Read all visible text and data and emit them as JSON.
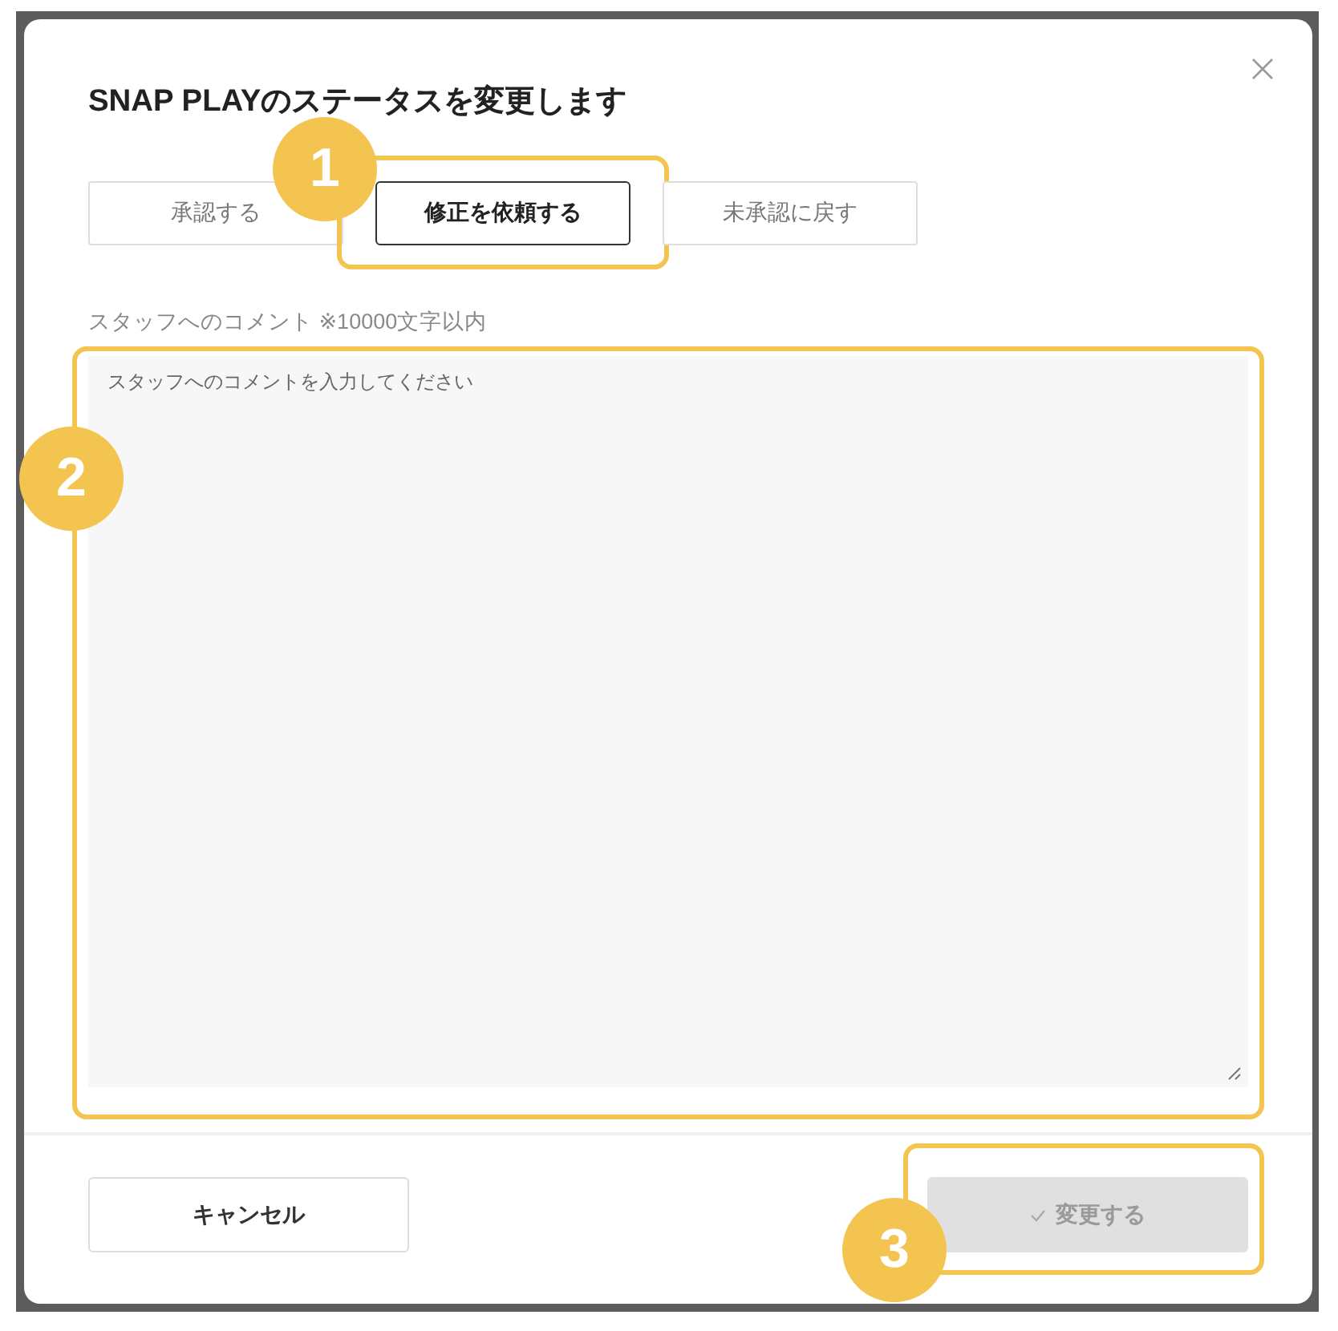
{
  "dialog": {
    "title": "SNAP PLAYのステータスを変更します",
    "tabs": [
      {
        "label": "承認する",
        "selected": false
      },
      {
        "label": "修正を依頼する",
        "selected": true,
        "callout": "1"
      },
      {
        "label": "未承認に戻す",
        "selected": false
      }
    ],
    "comment": {
      "label": "スタッフへのコメント ※10000文字以内",
      "placeholder": "スタッフへのコメントを入力してください",
      "callout": "2"
    },
    "buttons": [
      {
        "kind": "cancel",
        "label": "キャンセル",
        "disabled": false
      },
      {
        "kind": "submit",
        "label": "変更する",
        "disabled": true,
        "callout": "3"
      }
    ]
  }
}
